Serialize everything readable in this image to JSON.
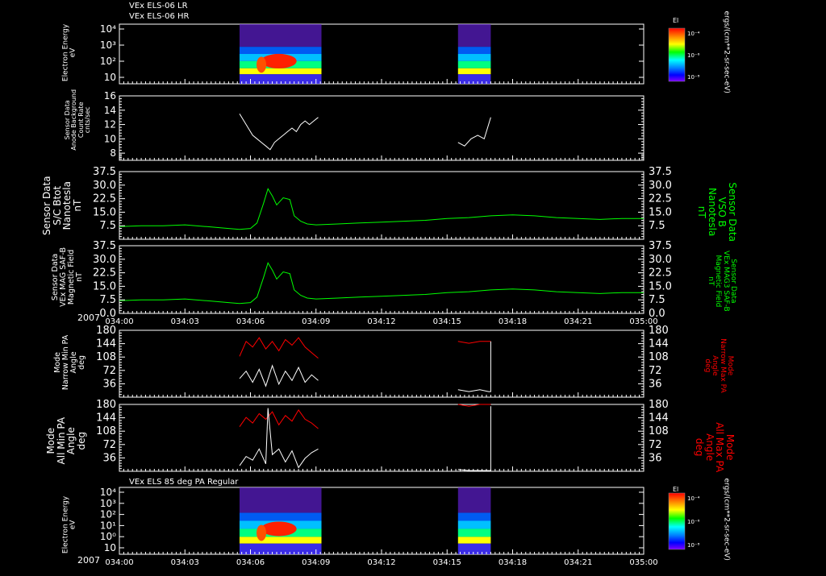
{
  "headers": {
    "top_line1": "VEx ELS-06 LR",
    "top_line2": "VEx ELS-06 HR",
    "bottom": "VEx ELS 85 deg PA Regular"
  },
  "year_label": "2007",
  "time_ticks": [
    "034:00",
    "034:03",
    "034:06",
    "034:09",
    "034:12",
    "034:15",
    "034:18",
    "034:21",
    "035:00"
  ],
  "colorbar": {
    "title": "El",
    "unit_label": "ergs/(cm**2-sr-sec-eV)",
    "ticks": [
      "10⁻⁴",
      "10⁻⁶",
      "10⁻⁸"
    ],
    "colors": [
      "#ff0000",
      "#ff8000",
      "#ffff00",
      "#00ff00",
      "#00ffff",
      "#0080ff",
      "#0000ff",
      "#8000ff"
    ]
  },
  "colors": {
    "green": "#00ff00",
    "red": "#ff0000",
    "white": "#ffffff"
  },
  "chart_data": [
    {
      "type": "heatmap",
      "title": "VEx ELS-06 LR / VEx ELS-06 HR",
      "ylabel": [
        "Electron Energy",
        "eV"
      ],
      "y_scale": "log",
      "y_tick_labels": [
        "10⁴",
        "10³",
        "10²",
        "10"
      ],
      "data_intervals": [
        [
          "034:05:30",
          "034:09:15"
        ],
        [
          "034:15:30",
          "034:17:00"
        ]
      ]
    },
    {
      "type": "line",
      "ylabel": [
        "Sensor Data",
        "Anode Background",
        "Count Rate",
        "cnts/sec"
      ],
      "ylim": [
        7,
        16
      ],
      "yticks": [
        8,
        10,
        12,
        14,
        16
      ],
      "series": [
        {
          "color": "white",
          "segments": [
            {
              "x": [
                5.5,
                5.7,
                5.9,
                6.1,
                6.3,
                6.5,
                6.7,
                6.9,
                7.1,
                7.3,
                7.5,
                7.7,
                7.9,
                8.1,
                8.3,
                8.5,
                8.7,
                8.9,
                9.1
              ],
              "y": [
                13.5,
                12.5,
                11.5,
                10.5,
                10.0,
                9.5,
                9.0,
                8.5,
                9.5,
                10.0,
                10.5,
                11.0,
                11.5,
                11.0,
                12.0,
                12.5,
                12.0,
                12.5,
                13.0
              ]
            },
            {
              "x": [
                15.5,
                15.8,
                16.1,
                16.4,
                16.7,
                17.0
              ],
              "y": [
                9.5,
                9.0,
                10.0,
                10.5,
                10.0,
                13.0
              ]
            }
          ]
        }
      ]
    },
    {
      "type": "line",
      "ylabel": [
        "Sensor Data",
        "S/C Btot",
        "Nanotesla",
        "nT"
      ],
      "ylabel_right": [
        "Sensor Data",
        "VSO B",
        "Nanotesla",
        "nT"
      ],
      "ylim": [
        0,
        37.5
      ],
      "yticks": [
        7.5,
        15.0,
        22.5,
        30.0,
        37.5
      ],
      "ytick_labels": [
        "7.5",
        "15.0",
        "22.5",
        "30.0",
        "37.5"
      ],
      "series": [
        {
          "color": "green",
          "segments": [
            {
              "x": [
                0,
                1,
                2,
                3,
                4,
                5,
                5.5,
                6,
                6.3,
                6.6,
                6.8,
                7.0,
                7.2,
                7.5,
                7.8,
                8.0,
                8.3,
                8.6,
                9,
                10,
                11,
                12,
                13,
                14,
                15,
                16,
                17,
                18,
                19,
                20,
                21,
                22,
                23,
                24
              ],
              "y": [
                7,
                7.5,
                7.5,
                8,
                7,
                6,
                5.5,
                6,
                9,
                20,
                28,
                24,
                19,
                23,
                22,
                13,
                10,
                8.5,
                8,
                8.5,
                9,
                9.5,
                10,
                10.5,
                11.5,
                12,
                13,
                13.5,
                13,
                12,
                11.5,
                11,
                11.5,
                11.5
              ]
            }
          ]
        }
      ]
    },
    {
      "type": "line",
      "ylabel": [
        "Sensor Data",
        "VEx MAG SAF-B",
        "Magnetic Field",
        "nT"
      ],
      "ylabel_right": [
        "Sensor Data",
        "VEx MAG3 SAF-B",
        "Magnetic Field",
        "nT"
      ],
      "ylim": [
        0,
        37.5
      ],
      "yticks": [
        0.0,
        7.5,
        15.0,
        22.5,
        30.0,
        37.5
      ],
      "ytick_labels": [
        "0.0",
        "7.5",
        "15.0",
        "22.5",
        "30.0",
        "37.5"
      ],
      "series": [
        {
          "color": "green",
          "segments": [
            {
              "x": [
                0,
                1,
                2,
                3,
                4,
                5,
                5.5,
                6,
                6.3,
                6.6,
                6.8,
                7.0,
                7.2,
                7.5,
                7.8,
                8.0,
                8.3,
                8.6,
                9,
                10,
                11,
                12,
                13,
                14,
                15,
                16,
                17,
                18,
                19,
                20,
                21,
                22,
                23,
                24
              ],
              "y": [
                7,
                7.5,
                7.5,
                8,
                7,
                6,
                5.5,
                6,
                9,
                20,
                28,
                24,
                19,
                23,
                22,
                13,
                10,
                8.5,
                8,
                8.5,
                9,
                9.5,
                10,
                10.5,
                11.5,
                12,
                13,
                13.5,
                13,
                12,
                11.5,
                11,
                11.5,
                11.5
              ]
            }
          ]
        }
      ]
    },
    {
      "type": "line",
      "ylabel": [
        "Mode",
        "Narrow Min PA",
        "Angle",
        "deg"
      ],
      "ylabel_right": [
        "Mode",
        "Narrow Max PA",
        "Angle",
        "deg"
      ],
      "ylim": [
        0,
        180
      ],
      "yticks": [
        36,
        72,
        108,
        144,
        180
      ],
      "series": [
        {
          "color": "red",
          "segments": [
            {
              "x": [
                5.5,
                5.8,
                6.1,
                6.4,
                6.7,
                7.0,
                7.3,
                7.6,
                7.9,
                8.2,
                8.5,
                8.8,
                9.1
              ],
              "y": [
                110,
                150,
                135,
                160,
                130,
                150,
                125,
                155,
                140,
                160,
                135,
                120,
                105
              ]
            },
            {
              "x": [
                15.5,
                16.0,
                16.5,
                17.0
              ],
              "y": [
                150,
                145,
                150,
                150
              ]
            }
          ]
        },
        {
          "color": "white",
          "segments": [
            {
              "x": [
                5.5,
                5.8,
                6.1,
                6.4,
                6.7,
                7.0,
                7.3,
                7.6,
                7.9,
                8.2,
                8.5,
                8.8,
                9.1
              ],
              "y": [
                50,
                70,
                40,
                75,
                30,
                85,
                35,
                70,
                45,
                80,
                40,
                60,
                45
              ]
            },
            {
              "x": [
                15.5,
                16.0,
                16.5,
                16.9,
                17.0,
                17.0
              ],
              "y": [
                20,
                15,
                20,
                15,
                15,
                150
              ]
            }
          ]
        }
      ]
    },
    {
      "type": "line",
      "ylabel": [
        "Mode",
        "All Min PA",
        "Angle",
        "deg"
      ],
      "ylabel_right": [
        "Mode",
        "All Max PA",
        "Angle",
        "deg"
      ],
      "ylim": [
        0,
        180
      ],
      "yticks": [
        36,
        72,
        108,
        144,
        180
      ],
      "series": [
        {
          "color": "red",
          "segments": [
            {
              "x": [
                5.5,
                5.8,
                6.1,
                6.4,
                6.7,
                7.0,
                7.3,
                7.6,
                7.9,
                8.2,
                8.5,
                8.8,
                9.1
              ],
              "y": [
                120,
                145,
                130,
                155,
                140,
                160,
                125,
                150,
                135,
                165,
                140,
                130,
                115
              ]
            },
            {
              "x": [
                15.5,
                16.0,
                16.5,
                17.0
              ],
              "y": [
                180,
                175,
                180,
                180
              ]
            }
          ]
        },
        {
          "color": "white",
          "segments": [
            {
              "x": [
                5.5,
                5.8,
                6.1,
                6.4,
                6.7,
                6.8,
                7.0,
                7.3,
                7.6,
                7.9,
                8.2,
                8.5,
                8.8,
                9.1
              ],
              "y": [
                15,
                40,
                30,
                60,
                20,
                170,
                45,
                60,
                25,
                55,
                10,
                35,
                50,
                60
              ]
            },
            {
              "x": [
                15.5,
                16.0,
                16.5,
                16.9,
                17.0,
                17.0
              ],
              "y": [
                5,
                2,
                2,
                2,
                2,
                175
              ]
            }
          ]
        }
      ]
    },
    {
      "type": "heatmap",
      "title": "VEx ELS 85 deg PA Regular",
      "ylabel": [
        "Electron Energy",
        "eV"
      ],
      "y_scale": "log",
      "y_tick_labels": [
        "10⁴",
        "10³",
        "10²",
        "10¹",
        "10⁰",
        "10"
      ],
      "data_intervals": [
        [
          "034:05:30",
          "034:09:15"
        ],
        [
          "034:15:30",
          "034:17:00"
        ]
      ]
    }
  ]
}
